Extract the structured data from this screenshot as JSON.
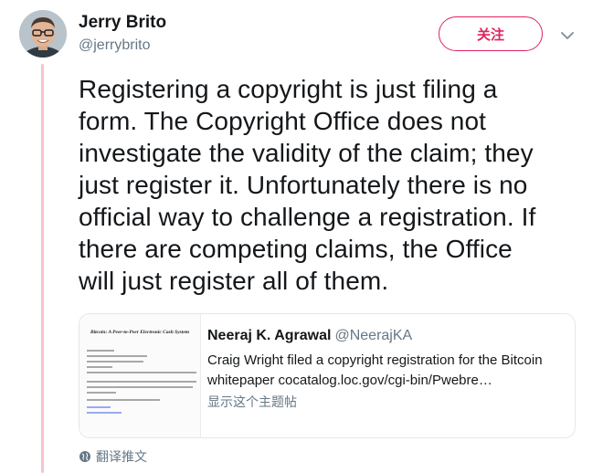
{
  "author": {
    "name": "Jerry Brito",
    "handle": "@jerrybrito"
  },
  "actions": {
    "follow_label": "关注",
    "menu_icon": "chevron-down-icon"
  },
  "tweet": {
    "text": "Registering a copyright is just filing a\nform. The Copyright Office does not\ninvestigate the validity of the claim; they\njust register it. Unfortunately there is no\nofficial way to challenge a registration. If\nthere are competing claims, the Office\nwill just register all of them."
  },
  "quoted_tweet": {
    "name": "Neeraj K. Agrawal",
    "handle": "@NeerajKA",
    "text": "Craig Wright filed a copyright registration for the Bitcoin\nwhitepaper cocatalog.loc.gov/cgi-bin/Pwebre…",
    "show_thread_label": "显示这个主题帖",
    "thumbnail_title": "Bitcoin: A Peer-to-Peer Electronic Cash System"
  },
  "translate": {
    "label": "翻译推文",
    "icon": "globe-icon"
  },
  "colors": {
    "accent": "#e0245e",
    "thread_line": "#f4c4cc",
    "secondary_text": "#657786"
  }
}
